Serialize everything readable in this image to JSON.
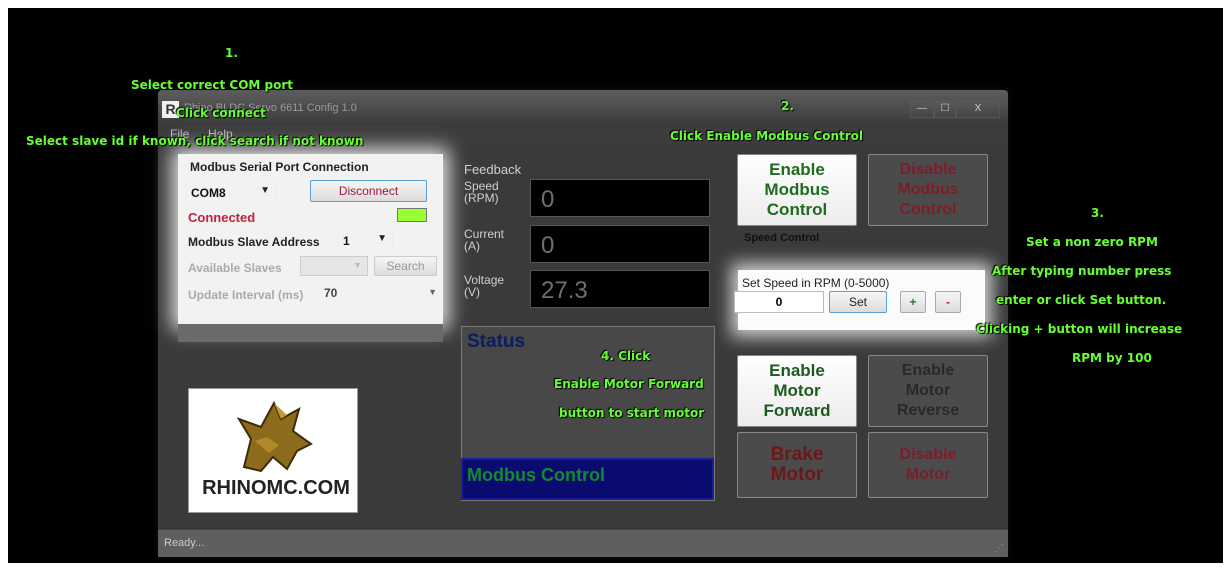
{
  "window": {
    "app_icon": "R",
    "title": "Rhino BLDC Servo 6611 Config 1.0",
    "minimize_glyph": "—",
    "maximize_glyph": "☐",
    "close_glyph": "X"
  },
  "menu": {
    "file": "File",
    "help": "Help"
  },
  "connection": {
    "header": "Modbus Serial Port Connection",
    "port_value": "COM8",
    "disconnect_label": "Disconnect",
    "status_text": "Connected",
    "status_color": "#99ff33",
    "slave_address_label": "Modbus Slave Address",
    "slave_address_value": "1",
    "available_slaves_label": "Available Slaves",
    "search_label": "Search",
    "update_interval_label": "Update Interval (ms)",
    "update_interval_value": "70"
  },
  "logo": {
    "text": "RHINOMC.COM"
  },
  "feedback": {
    "header": "Feedback",
    "speed_label_1": "Speed",
    "speed_label_2": "(RPM)",
    "speed_value": "0",
    "current_label_1": "Current",
    "current_label_2": "(A)",
    "current_value": "0",
    "voltage_label_1": "Voltage",
    "voltage_label_2": "(V)",
    "voltage_value": "27.3"
  },
  "status": {
    "title": "Status",
    "mode_text": "Modbus Control"
  },
  "modbus_buttons": {
    "enable_line1": "Enable",
    "enable_line2": "Modbus",
    "enable_line3": "Control",
    "disable_line1": "Disable",
    "disable_line2": "Modbus",
    "disable_line3": "Control"
  },
  "speed_control": {
    "header": "Speed Control",
    "set_speed_label": "Set Speed in RPM (0-5000)",
    "speed_input_value": "0",
    "set_label": "Set",
    "plus_label": "+",
    "minus_label": "-"
  },
  "motor_buttons": {
    "fwd_line1": "Enable",
    "fwd_line2": "Motor",
    "fwd_line3": "Forward",
    "rev_line1": "Enable",
    "rev_line2": "Motor",
    "rev_line3": "Reverse",
    "brake_line1": "Brake",
    "brake_line2": "Motor",
    "disable_line1": "Disable",
    "disable_line2": "Motor"
  },
  "statusbar": {
    "text": "Ready..."
  },
  "annotations": {
    "step1_num": "1.",
    "step1_line1": "Select correct COM port",
    "step1_line2": "Click connect",
    "step1_line3": "Select slave id if known, click search if not known",
    "step2_num": "2.",
    "step2_line1": "Click Enable Modbus Control",
    "step3_num": "3.",
    "step3_line1": "Set a non zero RPM",
    "step3_line2": "After typing number press",
    "step3_line3": "enter or click Set button.",
    "step3_line4": "Clicking + button will increase",
    "step3_line5": "RPM by 100",
    "step4_line1": "4. Click",
    "step4_line2": "Enable Motor Forward",
    "step4_line3": "button to start motor",
    "color": "#66ff33"
  }
}
